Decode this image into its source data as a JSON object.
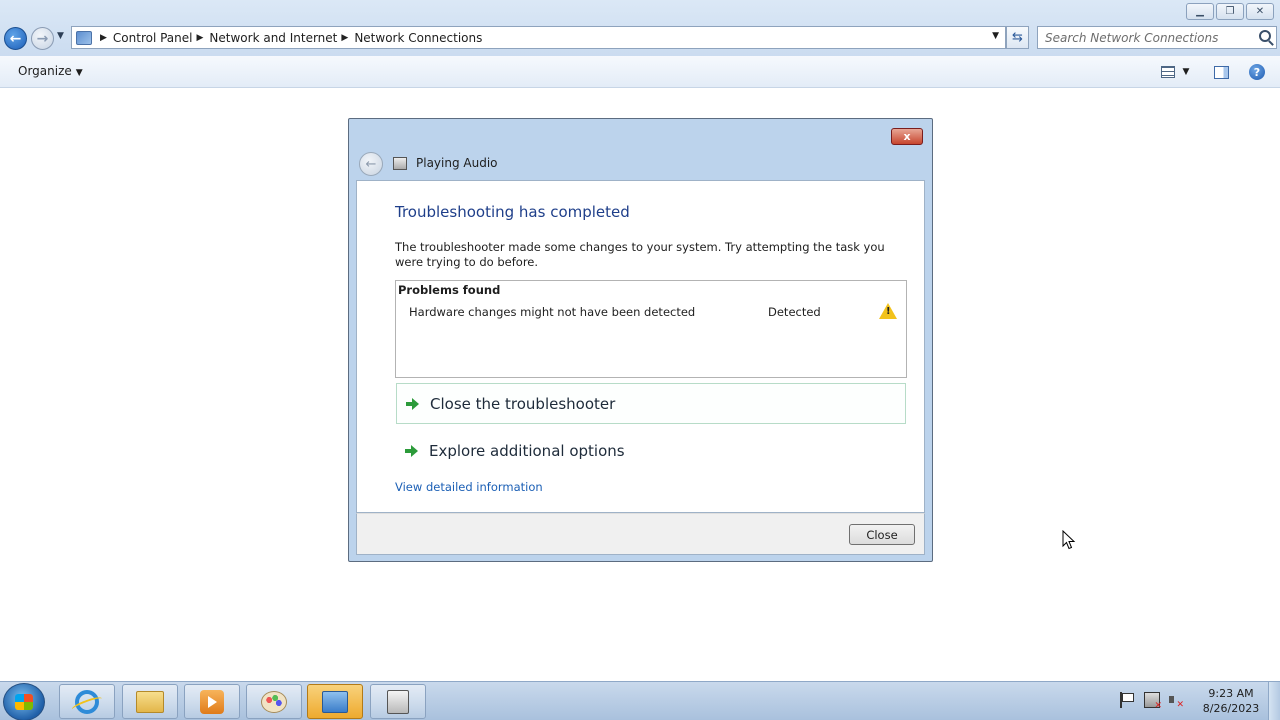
{
  "window": {
    "minimize_icon": "minimize-icon",
    "maximize_icon": "restore-icon",
    "close_icon": "close-icon"
  },
  "address_bar": {
    "breadcrumbs": [
      "Control Panel",
      "Network and Internet",
      "Network Connections"
    ]
  },
  "search": {
    "placeholder": "Search Network Connections"
  },
  "command_bar": {
    "organize_label": "Organize"
  },
  "dialog": {
    "title": "Playing Audio",
    "heading": "Troubleshooting has completed",
    "description": "The troubleshooter made some changes to your system. Try attempting the task you were trying to do before.",
    "problems_header": "Problems found",
    "problems": [
      {
        "name": "Hardware changes might not have been detected",
        "status": "Detected",
        "icon": "warning-icon"
      }
    ],
    "options": [
      {
        "label": "Close the troubleshooter"
      },
      {
        "label": "Explore additional options"
      }
    ],
    "detail_link": "View detailed information",
    "close_button": "Close",
    "close_x": "x"
  },
  "taskbar": {
    "time": "9:23 AM",
    "date": "8/26/2023"
  },
  "colors": {
    "heading_blue": "#1f3f8a",
    "link_blue": "#1b5fb5",
    "arrow_green": "#2c9b3a",
    "warning_yellow": "#f2c21b"
  }
}
